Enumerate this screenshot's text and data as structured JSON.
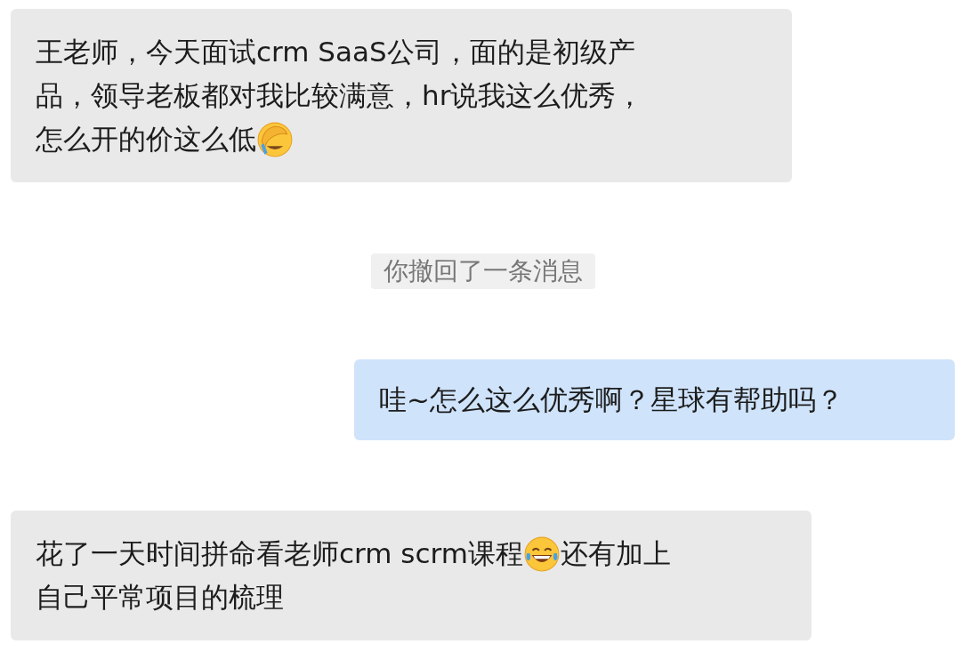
{
  "messages": [
    {
      "kind": "incoming",
      "lines": [
        [
          {
            "kind": "text",
            "text": "王老师，今天面试crm SaaS公司，面的是初级产"
          }
        ],
        [
          {
            "kind": "text",
            "text": "品，领导老板都对我比较满意，hr说我这么优秀，"
          }
        ],
        [
          {
            "kind": "text",
            "text": "怎么开的价这么低"
          },
          {
            "kind": "facepalm"
          }
        ]
      ]
    },
    {
      "kind": "notice",
      "text": "你撤回了一条消息"
    },
    {
      "kind": "outgoing",
      "lines": [
        [
          {
            "kind": "text",
            "text": "哇~怎么这么优秀啊？星球有帮助吗？"
          }
        ]
      ]
    },
    {
      "kind": "incoming",
      "lines": [
        [
          {
            "kind": "text",
            "text": "花了一天时间拼命看老师crm scrm课程"
          },
          {
            "kind": "laugh"
          },
          {
            "kind": "text",
            "text": "还有加上"
          }
        ],
        [
          {
            "kind": "text",
            "text": "自己平常项目的梳理"
          }
        ]
      ]
    }
  ]
}
